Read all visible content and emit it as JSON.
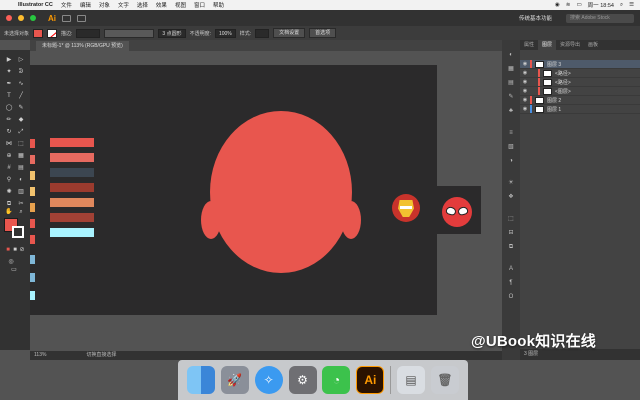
{
  "menubar": {
    "app": "Illustrator CC",
    "items": [
      "文件",
      "编辑",
      "对象",
      "文字",
      "选择",
      "效果",
      "视图",
      "窗口",
      "帮助"
    ],
    "clock": "周一 18:54"
  },
  "appbar": {
    "logo": "Ai",
    "workspace": "传统基本功能",
    "search_placeholder": "搜索 Adobe Stock"
  },
  "controlbar": {
    "selection": "未选择对象",
    "stroke_label": "描边:",
    "brush": "3 点圆形",
    "opacity_label": "不透明度:",
    "opacity": "100%",
    "style_label": "样式:",
    "doc_setup": "文档设置",
    "prefs": "首选项"
  },
  "document": {
    "tab": "未标题-1* @ 113% (RGB/GPU 预览)"
  },
  "palette": {
    "colors": [
      "#e8564e",
      "#e76a60",
      "#3c4651",
      "#9b3b2e",
      "#e0885d",
      "#a14135",
      "#a9f3ff"
    ]
  },
  "canvas": {
    "head_color": "#e8564e",
    "artboard_color": "#2b2a2b"
  },
  "layers_panel": {
    "tabs": [
      "属性",
      "图层",
      "资源导出",
      "画板"
    ],
    "rows": [
      {
        "name": "图层 3",
        "color": "#e8564e",
        "selected": true
      },
      {
        "name": "<路径>",
        "color": "#e8564e",
        "selected": false
      },
      {
        "name": "<路径>",
        "color": "#e8564e",
        "selected": false
      },
      {
        "name": "<图层>",
        "color": "#e8564e",
        "selected": false
      },
      {
        "name": "图层 2",
        "color": "#e8564e",
        "selected": false
      },
      {
        "name": "图层 1",
        "color": "#4a90e2",
        "selected": false
      }
    ],
    "footer": "3 图层"
  },
  "statusbar": {
    "zoom": "113%",
    "tool": "切换直接选择"
  },
  "dock": {
    "apps": [
      "Finder",
      "Launchpad",
      "Safari",
      "System Preferences",
      "WeChat",
      "Ai",
      "Preview",
      "Trash"
    ]
  },
  "watermark": "@UBook知识在线"
}
